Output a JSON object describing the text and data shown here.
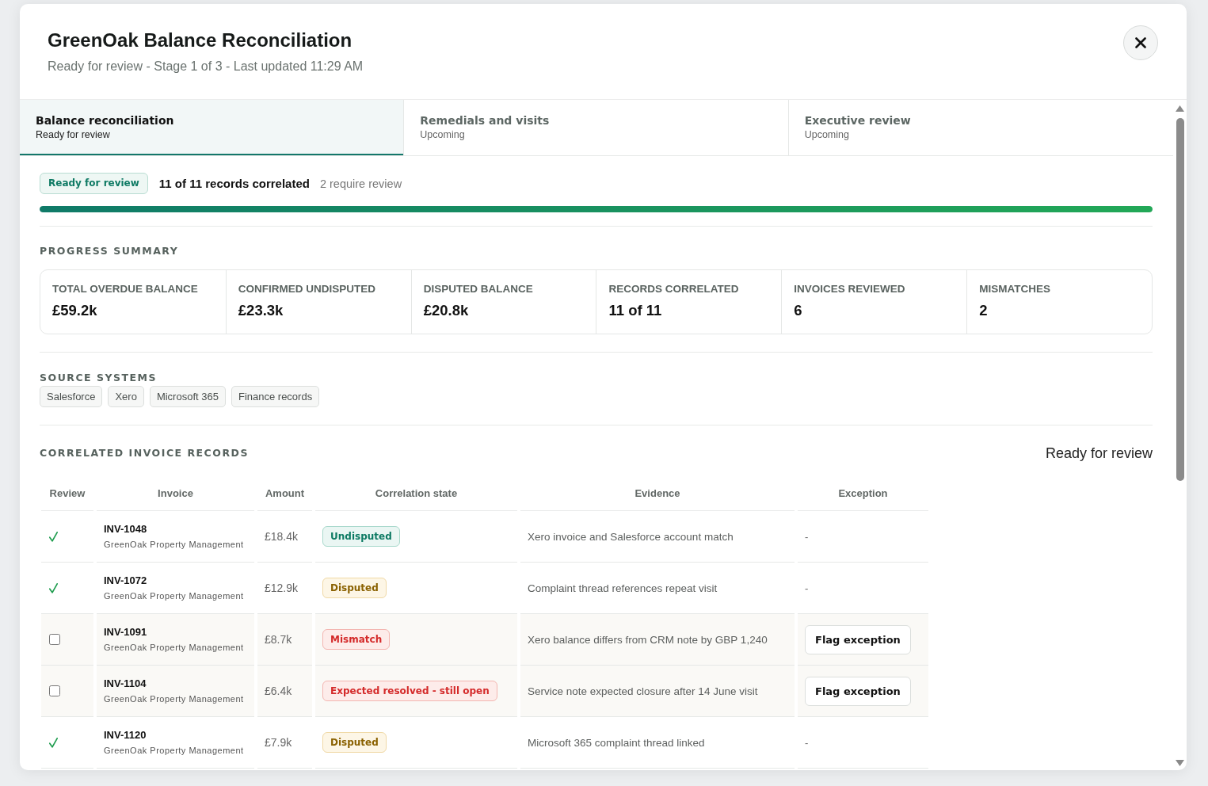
{
  "dialog": {
    "title": "GreenOak Balance Reconciliation",
    "subtitle": "Ready for review - Stage 1 of 3 - Last updated 11:29 AM"
  },
  "tabs": [
    {
      "title": "Balance reconciliation",
      "status": "Ready for review",
      "selected": true
    },
    {
      "title": "Remedials and visits",
      "status": "Upcoming",
      "selected": false
    },
    {
      "title": "Executive review",
      "status": "Upcoming",
      "selected": false
    }
  ],
  "status": {
    "badge": "Ready for review",
    "summary": "11 of 11 records correlated",
    "note": "2 require review",
    "level": 1
  },
  "progress_summary": {
    "heading": "PROGRESS SUMMARY",
    "stats": [
      {
        "label": "TOTAL OVERDUE BALANCE",
        "value": "£59.2k"
      },
      {
        "label": "CONFIRMED UNDISPUTED",
        "value": "£23.3k"
      },
      {
        "label": "DISPUTED BALANCE",
        "value": "£20.8k"
      },
      {
        "label": "RECORDS CORRELATED",
        "value": "11 of 11"
      },
      {
        "label": "INVOICES REVIEWED",
        "value": "6"
      },
      {
        "label": "MISMATCHES",
        "value": "2"
      }
    ]
  },
  "source_systems": {
    "heading": "SOURCE SYSTEMS",
    "chips": [
      "Salesforce",
      "Xero",
      "Microsoft 365",
      "Finance records"
    ]
  },
  "records": {
    "heading": "CORRELATED INVOICE RECORDS",
    "status": "Ready for review",
    "columns": [
      "Review",
      "Invoice",
      "Amount",
      "Correlation state",
      "Evidence",
      "Exception"
    ],
    "rows": [
      {
        "reviewed": true,
        "invoice": "INV-1048",
        "customer": "GreenOak Property Management",
        "amount": "£18.4k",
        "state": {
          "label": "Undisputed",
          "kind": "undisputed"
        },
        "evidence": "Xero invoice and Salesforce account match",
        "exception": {
          "kind": "text",
          "label": "-"
        }
      },
      {
        "reviewed": true,
        "invoice": "INV-1072",
        "customer": "GreenOak Property Management",
        "amount": "£12.9k",
        "state": {
          "label": "Disputed",
          "kind": "disputed"
        },
        "evidence": "Complaint thread references repeat visit",
        "exception": {
          "kind": "text",
          "label": "-"
        }
      },
      {
        "reviewed": false,
        "invoice": "INV-1091",
        "customer": "GreenOak Property Management",
        "amount": "£8.7k",
        "state": {
          "label": "Mismatch",
          "kind": "mismatch"
        },
        "evidence": "Xero balance differs from CRM note by GBP 1,240",
        "exception": {
          "kind": "button",
          "label": "Flag exception"
        }
      },
      {
        "reviewed": false,
        "invoice": "INV-1104",
        "customer": "GreenOak Property Management",
        "amount": "£6.4k",
        "state": {
          "label": "Expected resolved - still open",
          "kind": "open"
        },
        "evidence": "Service note expected closure after 14 June visit",
        "exception": {
          "kind": "button",
          "label": "Flag exception"
        }
      },
      {
        "reviewed": true,
        "invoice": "INV-1120",
        "customer": "GreenOak Property Management",
        "amount": "£7.9k",
        "state": {
          "label": "Disputed",
          "kind": "disputed"
        },
        "evidence": "Microsoft 365 complaint thread linked",
        "exception": {
          "kind": "text",
          "label": "-"
        }
      }
    ]
  }
}
